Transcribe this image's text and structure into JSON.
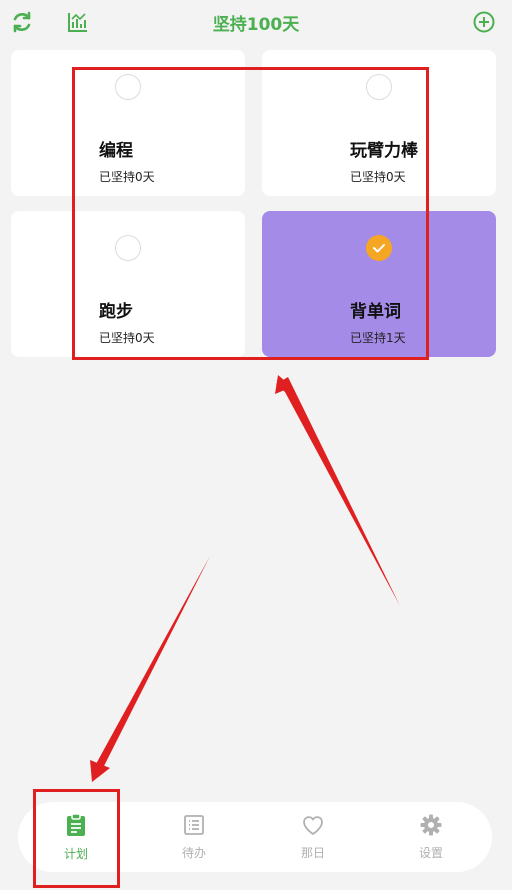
{
  "header": {
    "title": "坚持100天",
    "icons": [
      "refresh-icon",
      "chart-icon",
      "add-icon"
    ]
  },
  "cards": [
    {
      "name": "编程",
      "days": "已坚持0天",
      "done": false
    },
    {
      "name": "玩臂力棒",
      "days": "已坚持0天",
      "done": false
    },
    {
      "name": "跑步",
      "days": "已坚持0天",
      "done": false
    },
    {
      "name": "背单词",
      "days": "已坚持1天",
      "done": true
    }
  ],
  "tabs": [
    {
      "label": "计划",
      "icon": "clipboard-icon",
      "active": true
    },
    {
      "label": "待办",
      "icon": "list-icon",
      "active": false
    },
    {
      "label": "那日",
      "icon": "heart-icon",
      "active": false
    },
    {
      "label": "设置",
      "icon": "gear-icon",
      "active": false
    }
  ],
  "colors": {
    "accent": "#4caf50",
    "done_card": "#a58be8",
    "check_done": "#f5a623",
    "annotation": "#e02020"
  }
}
